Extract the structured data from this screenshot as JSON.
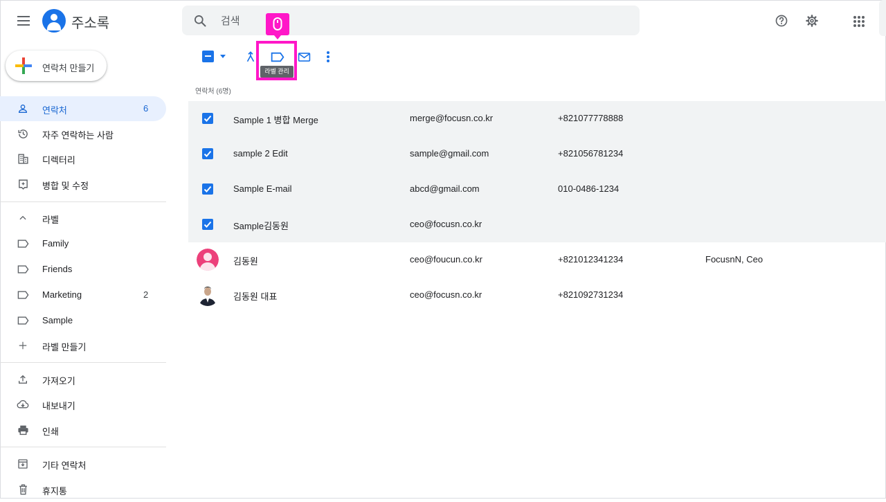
{
  "header": {
    "app_title": "주소록",
    "search_placeholder": "검색"
  },
  "sidebar": {
    "create_label": "연락처 만들기",
    "nav": [
      {
        "label": "연락처",
        "count": "6",
        "icon": "person-icon"
      },
      {
        "label": "자주 연락하는 사람",
        "count": "",
        "icon": "history-icon"
      },
      {
        "label": "디렉터리",
        "count": "",
        "icon": "building-icon"
      },
      {
        "label": "병합 및 수정",
        "count": "",
        "icon": "merge-fix-icon"
      }
    ],
    "labels_header": "라벨",
    "labels": [
      {
        "label": "Family",
        "count": ""
      },
      {
        "label": "Friends",
        "count": ""
      },
      {
        "label": "Marketing",
        "count": "2"
      },
      {
        "label": "Sample",
        "count": ""
      }
    ],
    "create_label_item": "라벨 만들기",
    "tools": [
      {
        "label": "가져오기",
        "icon": "upload-icon"
      },
      {
        "label": "내보내기",
        "icon": "cloud-download-icon"
      },
      {
        "label": "인쇄",
        "icon": "print-icon"
      }
    ],
    "other": [
      {
        "label": "기타 연락처",
        "icon": "archive-icon"
      },
      {
        "label": "휴지통",
        "icon": "trash-icon"
      }
    ]
  },
  "toolbar": {
    "tooltip": "라벨 관리",
    "accent": "#ff17c8"
  },
  "list": {
    "header": "연락처 (6명)",
    "rows": [
      {
        "name": "Sample 1 병합 Merge",
        "email": "merge@focusn.co.kr",
        "phone": "+821077778888",
        "org": "",
        "selected": true
      },
      {
        "name": "sample 2 Edit",
        "email": "sample@gmail.com",
        "phone": "+821056781234",
        "org": "",
        "selected": true
      },
      {
        "name": "Sample E-mail",
        "email": "abcd@gmail.com",
        "phone": "010-0486-1234",
        "org": "",
        "selected": true
      },
      {
        "name": "Sample김동원",
        "email": "ceo@focusn.co.kr",
        "phone": "",
        "org": "",
        "selected": true
      },
      {
        "name": "김동원",
        "email": "ceo@foucun.co.kr",
        "phone": "+821012341234",
        "org": "FocusnN, Ceo",
        "selected": false
      },
      {
        "name": "김동원 대표",
        "email": "ceo@focusn.co.kr",
        "phone": "+821092731234",
        "org": "",
        "selected": false
      }
    ]
  }
}
